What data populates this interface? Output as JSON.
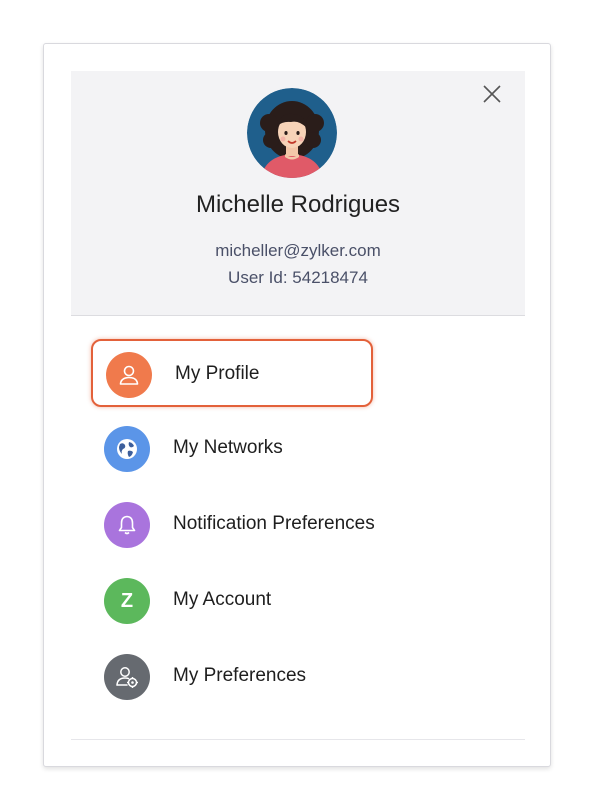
{
  "user": {
    "name": "Michelle Rodrigues",
    "email": "micheller@zylker.com",
    "user_id_label": "User Id: 54218474"
  },
  "header": {
    "close_icon": "close-icon"
  },
  "menu": {
    "items": [
      {
        "label": "My Profile",
        "icon": "user-icon",
        "color": "#f07a4c",
        "selected": true
      },
      {
        "label": "My Networks",
        "icon": "globe-icon",
        "color": "#5b95e8",
        "selected": false
      },
      {
        "label": "Notification Preferences",
        "icon": "bell-icon",
        "color": "#a974dd",
        "selected": false
      },
      {
        "label": "My Account",
        "icon": "z-icon",
        "icon_text": "Z",
        "color": "#5cb85c",
        "selected": false
      },
      {
        "label": "My Preferences",
        "icon": "user-settings-icon",
        "color": "#666a70",
        "selected": false
      }
    ]
  },
  "colors": {
    "selected_border": "#e3613a",
    "header_bg": "#f3f3f5"
  }
}
